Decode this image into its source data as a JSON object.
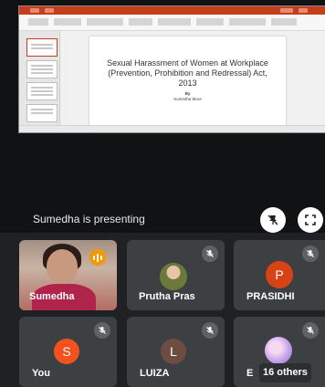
{
  "presentation": {
    "slide_title": "Sexual Harassment of Women at Workplace (Prevention, Prohibition and Redressal) Act, 2013",
    "slide_by": "By",
    "slide_author": "Sumedha More"
  },
  "presenter_bar": {
    "label": "Sumedha is presenting",
    "pin_icon": "unpin-icon",
    "fullscreen_icon": "fullscreen-icon"
  },
  "participants": [
    {
      "name": "Sumedha",
      "video": true,
      "speaking": true,
      "muted": false
    },
    {
      "name": "Prutha Pras",
      "avatar_type": "photo",
      "muted": true
    },
    {
      "name": "PRASIDHI",
      "initial": "P",
      "avatar_color": "#d84315",
      "muted": true
    },
    {
      "name": "You",
      "initial": "S",
      "avatar_color": "#f4511e",
      "muted": true
    },
    {
      "name": "LUIZA",
      "initial": "L",
      "avatar_color": "#6d4c41",
      "muted": true
    },
    {
      "name": "E",
      "avatar_type": "photo",
      "muted": true
    }
  ],
  "others": {
    "label": "16 others"
  },
  "colors": {
    "background": "#202124",
    "tile": "#3c4043",
    "speaking": "#f29900",
    "powerpoint": "#c43e1c"
  }
}
